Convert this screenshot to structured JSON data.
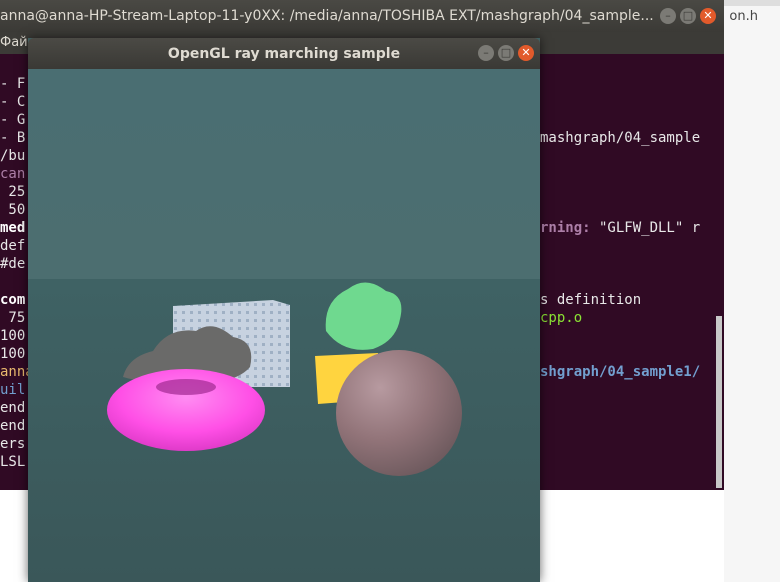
{
  "editor": {
    "tab_name": "on.h"
  },
  "terminal": {
    "title": "anna@anna-HP-Stream-Laptop-11-y0XX: /media/anna/TOSHIBA EXT/mashgraph/04_sample...",
    "menu_label": "Файл",
    "controls": {
      "minimize": "–",
      "maximize": "□",
      "close": "✕"
    },
    "left_lines": [
      "- F",
      "- C",
      "- G",
      "- B",
      "/bu",
      "can",
      " 25",
      " 50",
      "med",
      "def",
      "#de",
      "",
      "com",
      " 75",
      "100",
      "100",
      "anna",
      "uil",
      "end",
      "end",
      "ers",
      "LSL"
    ],
    "right_lines": [
      {
        "text": "mashgraph/04_sample",
        "cls": ""
      },
      {
        "text": "rning:",
        "cls": "c-purple",
        "rest": " \"GLFW_DLL\" r"
      },
      {
        "text": "s definition",
        "cls": ""
      },
      {
        "text": "cpp.o",
        "cls": "c-green"
      },
      {
        "text": "shgraph/04_sample1/",
        "cls": "c-blue"
      }
    ]
  },
  "gl_window": {
    "title": "OpenGL ray marching sample",
    "controls": {
      "minimize": "–",
      "maximize": "□",
      "close": "✕"
    }
  },
  "colors": {
    "terminal_bg": "#300a24",
    "scene_floor": "#3f5f60",
    "torus": "#ff4fe6",
    "sphere": "#9a7e84",
    "cube_yellow": "#ffd43f",
    "fractal_cube": "#c8d3e2",
    "foliage": "#6fd98f"
  }
}
